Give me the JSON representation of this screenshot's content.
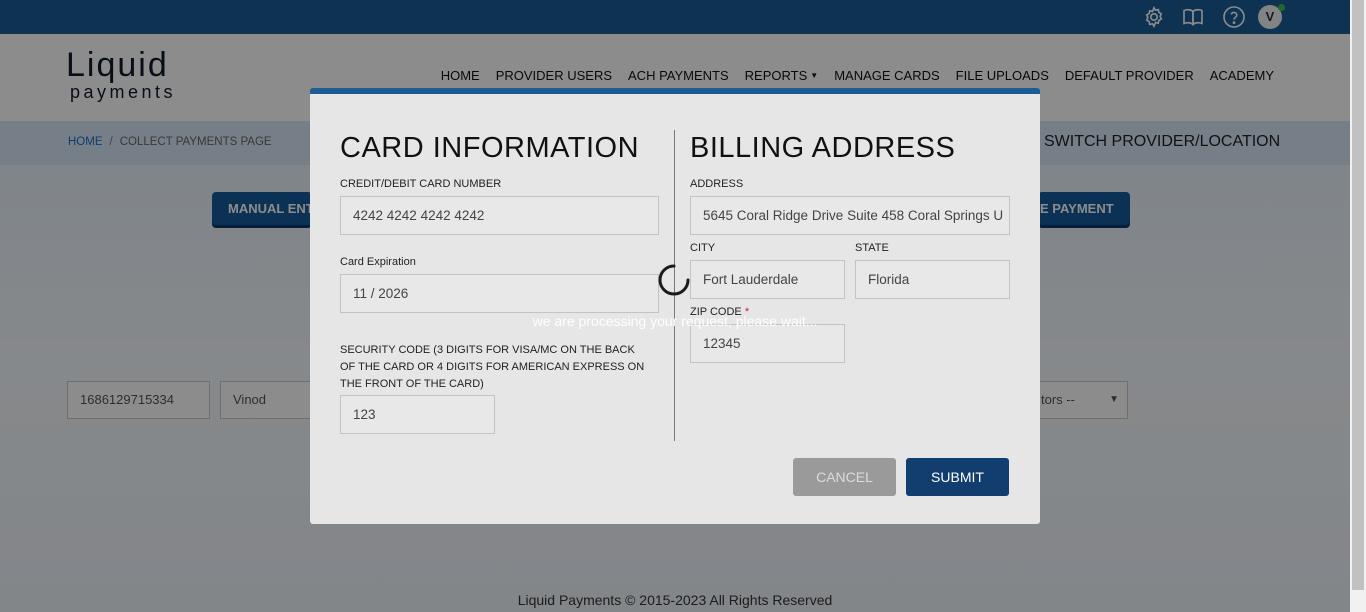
{
  "header": {
    "logo": {
      "top": "Liquid",
      "bottom": "payments"
    },
    "nav": [
      {
        "label": "HOME",
        "name": "nav-home"
      },
      {
        "label": "PROVIDER USERS",
        "name": "nav-provider-users"
      },
      {
        "label": "ACH PAYMENTS",
        "name": "nav-ach-payments"
      },
      {
        "label": "REPORTS",
        "name": "nav-reports",
        "has_dropdown": true
      },
      {
        "label": "MANAGE CARDS",
        "name": "nav-manage-cards"
      },
      {
        "label": "FILE UPLOADS",
        "name": "nav-file-uploads"
      },
      {
        "label": "DEFAULT PROVIDER",
        "name": "nav-default-provider"
      },
      {
        "label": "ACADEMY",
        "name": "nav-academy"
      }
    ],
    "avatar_initial": "V",
    "icons": [
      "gear-icon",
      "book-icon",
      "help-icon"
    ]
  },
  "breadcrumb": {
    "home": "HOME",
    "separator": "/",
    "current": "COLLECT PAYMENTS PAGE"
  },
  "switch_provider": "SWITCH PROVIDER/LOCATION",
  "background": {
    "manual_entry_label": "MANUAL ENT",
    "payment_button_label": "E PAYMENT",
    "account_value": "1686129715334",
    "name_value": "Vinod",
    "operators_select": "tors --"
  },
  "modal": {
    "card_section_title": "CARD INFORMATION",
    "card_number_label": "CREDIT/DEBIT CARD NUMBER",
    "card_number_value": "4242 4242 4242 4242",
    "expiration_label": "Card Expiration",
    "expiration_value": "11 / 2026",
    "security_label": "SECURITY CODE (3 DIGITS FOR VISA/MC ON THE BACK OF THE CARD OR 4 DIGITS FOR AMERICAN EXPRESS ON THE FRONT OF THE CARD)",
    "security_value": "123",
    "billing_section_title": "BILLING ADDRESS",
    "address_label": "ADDRESS",
    "address_value": "5645 Coral Ridge Drive Suite 458 Coral Springs U",
    "city_label": "CITY",
    "city_value": "Fort Lauderdale",
    "state_label": "STATE",
    "state_value": "Florida",
    "zip_label": "ZIP CODE",
    "zip_required_mark": "*",
    "zip_value": "12345",
    "cancel_label": "CANCEL",
    "submit_label": "SUBMIT"
  },
  "loading": {
    "message": "we are processing your request, please wait..."
  },
  "footer": "Liquid Payments © 2015-2023 All Rights Reserved",
  "colors": {
    "brand_blue": "#1a5d96",
    "submit_blue": "#113e6e",
    "required_red": "#c0262d"
  }
}
